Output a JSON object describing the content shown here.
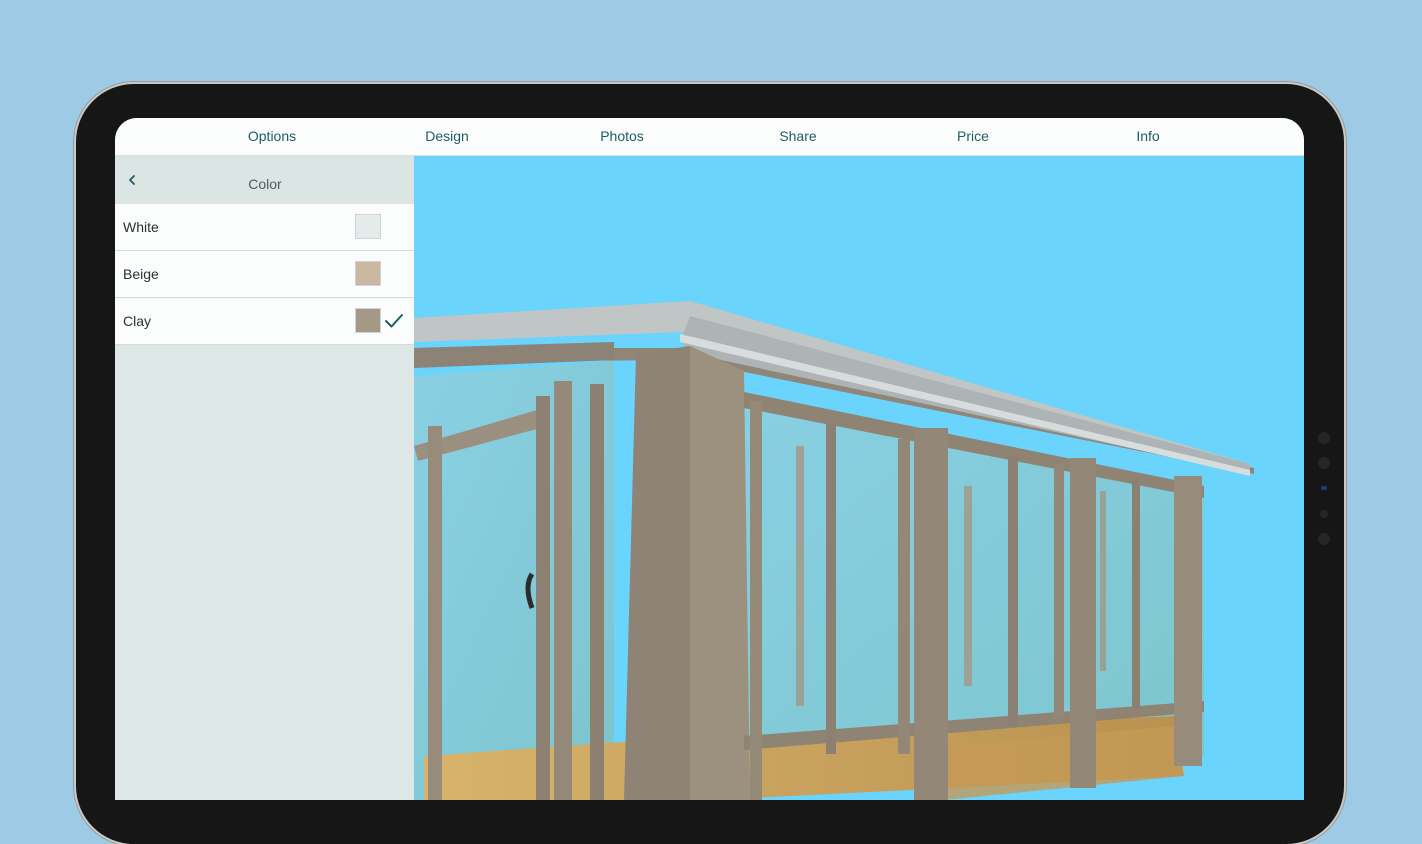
{
  "top_nav": {
    "items": [
      {
        "label": "Options"
      },
      {
        "label": "Design"
      },
      {
        "label": "Photos"
      },
      {
        "label": "Share"
      },
      {
        "label": "Price"
      },
      {
        "label": "Info"
      }
    ]
  },
  "color_panel": {
    "title": "Color",
    "back_icon": "chevron-left-icon",
    "options": [
      {
        "label": "White",
        "swatch": "#e4ebeb",
        "selected": false
      },
      {
        "label": "Beige",
        "swatch": "#c9b7a2",
        "selected": false
      },
      {
        "label": "Clay",
        "swatch": "#a69887",
        "selected": true
      }
    ],
    "selected_icon": "checkmark-icon"
  },
  "theme": {
    "accent": "#1d5e63",
    "sky": "#6ad4fc",
    "frame": "#938779",
    "roof": "#bcc2c2",
    "floor": "#c9a35e"
  }
}
